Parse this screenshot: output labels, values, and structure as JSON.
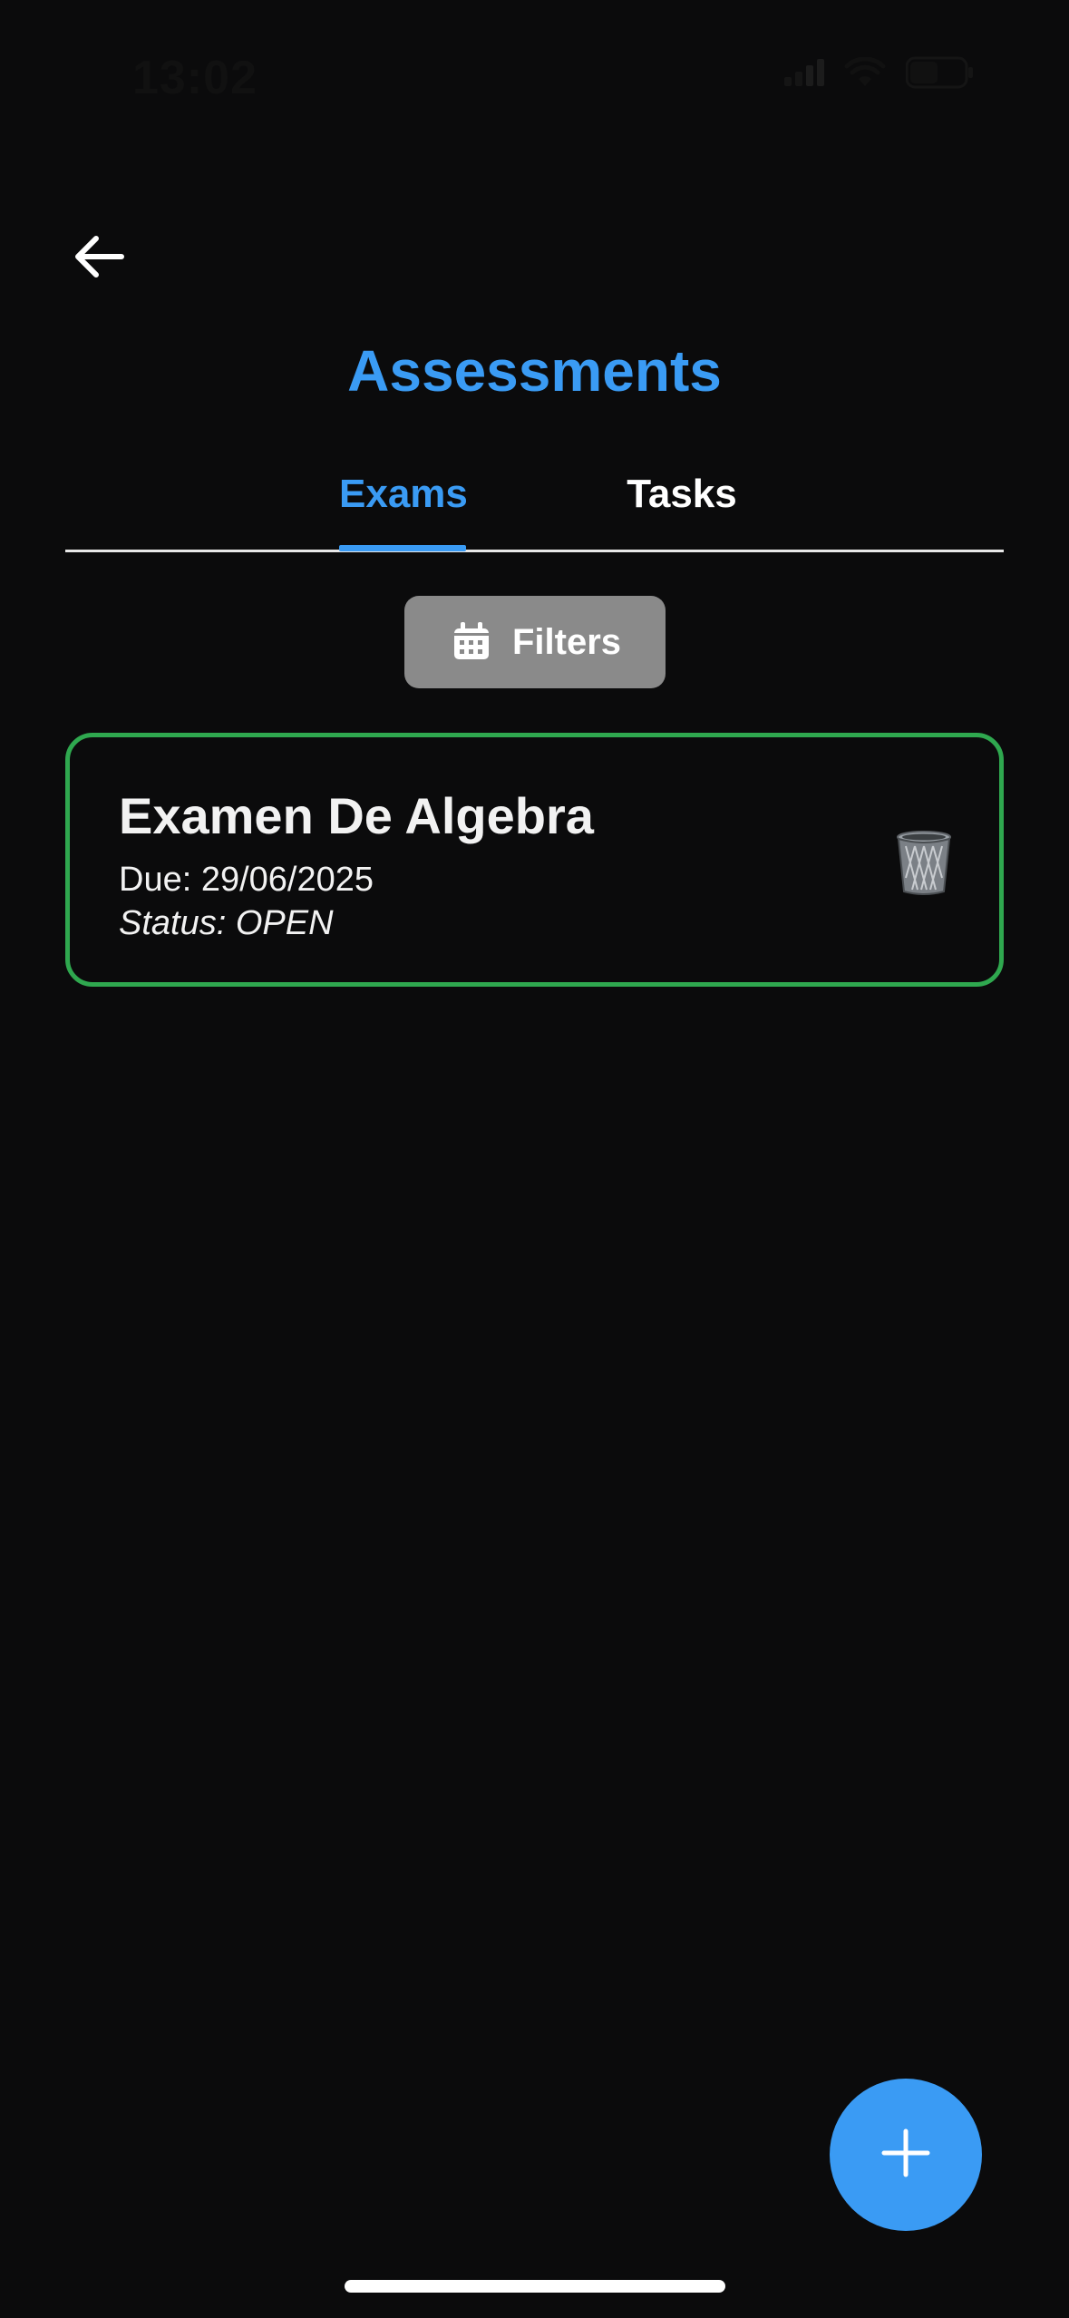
{
  "status_bar": {
    "time": "13:02",
    "icons": [
      "cellular-signal-icon",
      "wifi-icon",
      "battery-icon"
    ]
  },
  "header": {
    "back_icon": "arrow-left-icon",
    "title": "Assessments"
  },
  "tabs": [
    {
      "label": "Exams",
      "active": true
    },
    {
      "label": "Tasks",
      "active": false
    }
  ],
  "filters": {
    "icon": "calendar-icon",
    "label": "Filters"
  },
  "assessments": [
    {
      "title": "Examen De Algebra",
      "due": "Due: 29/06/2025",
      "status": "Status: OPEN",
      "delete_icon": "trash-can-icon"
    }
  ],
  "fab": {
    "icon": "plus-icon"
  },
  "colors": {
    "background": "#0b0b0c",
    "accent": "#3a9bf4",
    "card_border": "#2fa84f",
    "filter_button": "#8a8a8a"
  }
}
